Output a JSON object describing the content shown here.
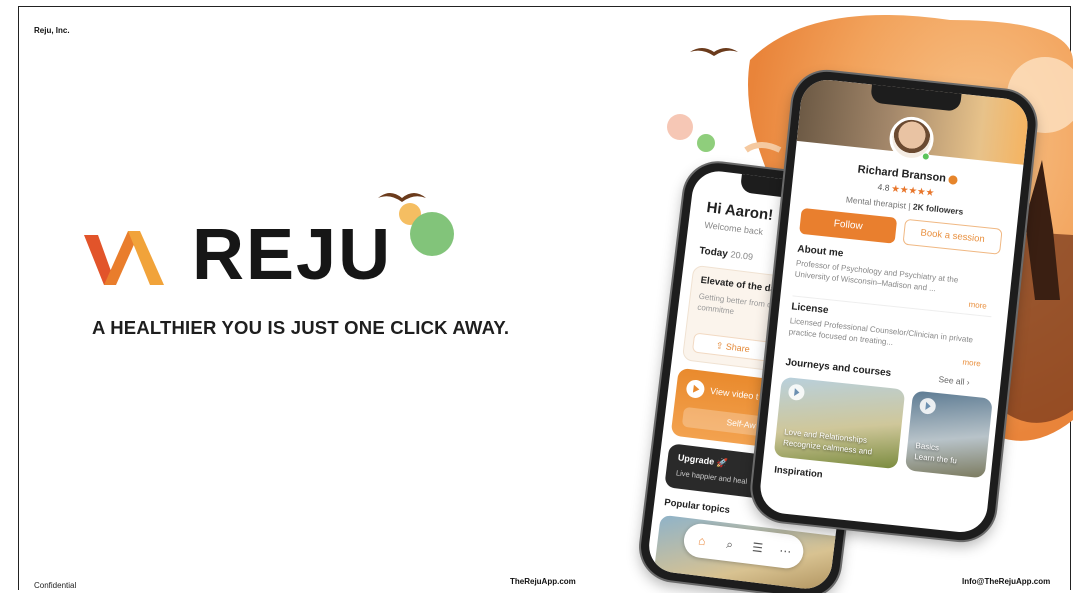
{
  "header": {
    "company": "Reju, Inc."
  },
  "brand": {
    "wordmark": "REJU",
    "tagline": "A HEALTHIER YOU IS JUST ONE CLICK AWAY."
  },
  "footer": {
    "left": "Confidential",
    "center": "TheRejuApp.com",
    "right": "Info@TheRejuApp.com"
  },
  "colors": {
    "accent": "#e97f2e",
    "accent_light": "#f6a45a",
    "green": "#7fc07a",
    "dark": "#161616"
  },
  "phone_home": {
    "greeting": "Hi Aaron! 👋",
    "subtitle": "Welcome back",
    "today_label": "Today",
    "today_date": "20.09",
    "card_title": "Elevate of the da",
    "card_text": "Getting better from depression demand lifelong commitme",
    "share_label": "Share",
    "video_label": "View video t",
    "video_button": "Self-Aw",
    "upgrade_title": "Upgrade 🚀",
    "upgrade_text": "Live happier and heal",
    "popular_label": "Popular topics",
    "tab_icons": [
      "home-icon",
      "search-icon",
      "list-icon",
      "more-icon"
    ]
  },
  "phone_profile": {
    "name": "Richard Branson",
    "rating": "4.8",
    "stars": "★★★★★",
    "role": "Mental therapist",
    "followers": "2K followers",
    "follow_label": "Follow",
    "book_label": "Book a session",
    "about_title": "About me",
    "about_text": "Professor of Psychology and Psychiatry at the University of Wisconsin–Madison and ...",
    "more_label": "more",
    "license_title": "License",
    "license_text": "Licensed Professional Counselor/Clinician in private practice focused on treating...",
    "journeys_title": "Journeys and courses",
    "see_all": "See all",
    "course1": "Love and Relationships",
    "course1_sub": "Recognize calmness and",
    "course2": "Basics",
    "course2_sub": "Learn the fu",
    "inspiration": "Inspiration"
  }
}
